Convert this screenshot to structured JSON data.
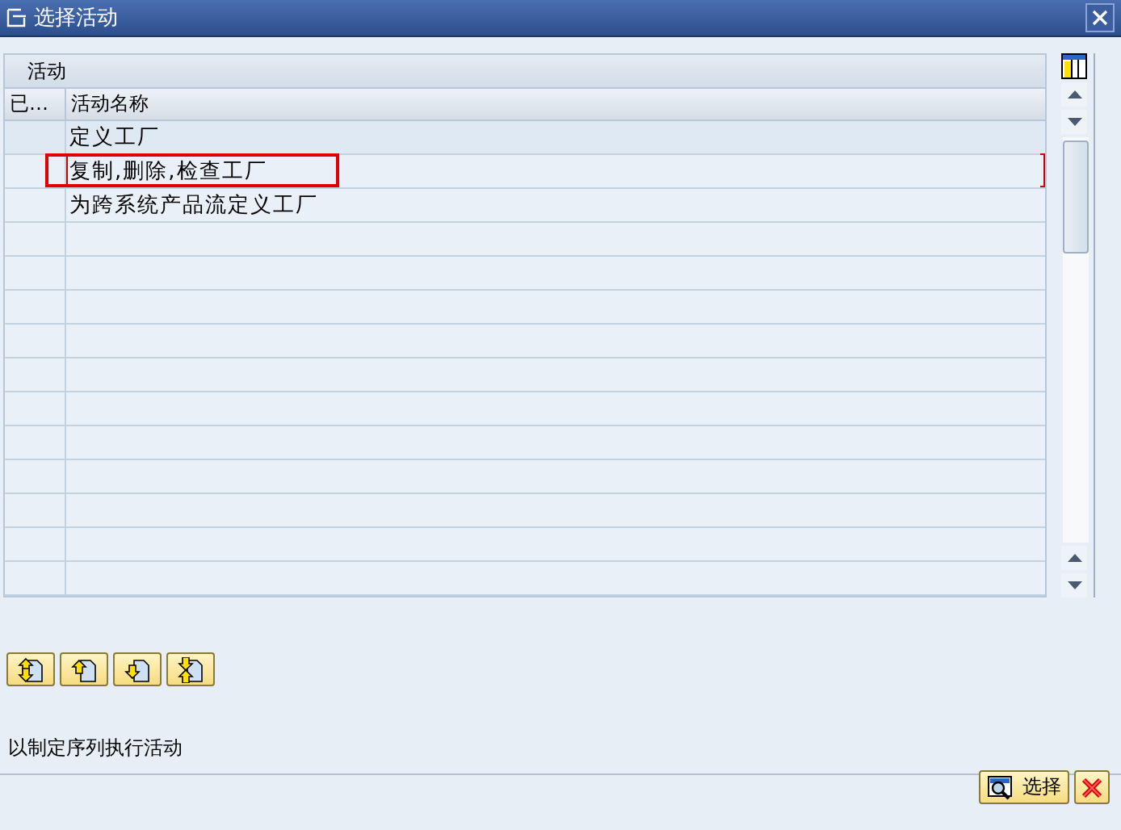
{
  "window": {
    "title": "选择活动"
  },
  "table": {
    "title": "活动",
    "columns": [
      "已…",
      "活动名称"
    ],
    "rows": [
      {
        "name": "定义工厂",
        "highlighted": false,
        "focused": false
      },
      {
        "name": "复制,删除,检查工厂",
        "highlighted": true,
        "focused": true
      },
      {
        "name": "为跨系统产品流定义工厂",
        "highlighted": false,
        "focused": false
      }
    ]
  },
  "order_buttons": [
    {
      "kind": "up-down"
    },
    {
      "kind": "up"
    },
    {
      "kind": "down"
    },
    {
      "kind": "down-up"
    }
  ],
  "status_text": "以制定序列执行活动",
  "footer_buttons": [
    {
      "kind": "select",
      "label": "选择"
    },
    {
      "kind": "cancel"
    }
  ]
}
